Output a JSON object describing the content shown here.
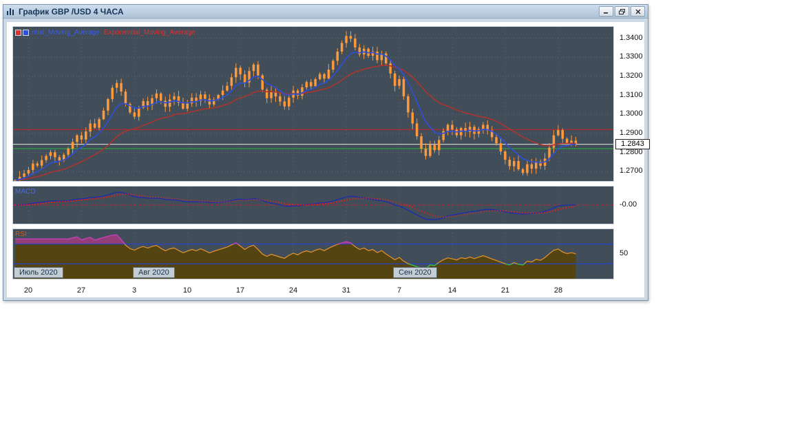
{
  "window": {
    "title": "График GBP /USD  4 ЧАСА"
  },
  "legend": {
    "ma1_label": "ntial_Moving_Average",
    "ma2_label": "Exponential_Moving_Average"
  },
  "panels": {
    "macd_label": "MACD",
    "rsi_label": "RSI"
  },
  "axis": {
    "price_ticks": [
      "1.3400",
      "1.3300",
      "1.3200",
      "1.3100",
      "1.3000",
      "1.2900",
      "1.2800",
      "1.2700"
    ],
    "current_price": "1.2843",
    "macd_zero": "-0.00",
    "rsi_mid": "50",
    "x_ticks": [
      "20",
      "27",
      "3",
      "10",
      "17",
      "24",
      "31",
      "7",
      "14",
      "21",
      "28"
    ]
  },
  "month_markers": [
    {
      "label": "Июль 2020",
      "slot": 0
    },
    {
      "label": "Авг 2020",
      "slot": 27
    },
    {
      "label": "Сен 2020",
      "slot": 86
    }
  ],
  "chart_data": {
    "type": "candlestick",
    "symbol": "GBP/USD",
    "timeframe": "4 часа",
    "title": "График GBP /USD 4 ЧАСА",
    "x_ticks": [
      "20",
      "27",
      "3",
      "10",
      "17",
      "24",
      "31",
      "7",
      "14",
      "21",
      "28"
    ],
    "x_tick_meaning": "dates Jul 20 2020 - Sep 28 2020, weekly",
    "price_panel": {
      "ylim": [
        1.265,
        1.346
      ],
      "gridline_prices": [
        1.27,
        1.28,
        1.29,
        1.3,
        1.31,
        1.32,
        1.33,
        1.34
      ],
      "closes": [
        1.2655,
        1.2672,
        1.269,
        1.2708,
        1.2742,
        1.2731,
        1.276,
        1.2782,
        1.2801,
        1.2775,
        1.2758,
        1.2788,
        1.282,
        1.2855,
        1.289,
        1.2868,
        1.291,
        1.2952,
        1.293,
        1.2975,
        1.302,
        1.308,
        1.314,
        1.3165,
        1.312,
        1.3055,
        1.301,
        1.2988,
        1.3035,
        1.307,
        1.3048,
        1.3085,
        1.311,
        1.3072,
        1.304,
        1.3078,
        1.3095,
        1.3062,
        1.303,
        1.3058,
        1.3088,
        1.307,
        1.3105,
        1.3082,
        1.3052,
        1.3078,
        1.3102,
        1.3125,
        1.315,
        1.3195,
        1.3245,
        1.321,
        1.3168,
        1.3228,
        1.3262,
        1.3205,
        1.313,
        1.3085,
        1.3122,
        1.3095,
        1.3068,
        1.3042,
        1.3088,
        1.3125,
        1.3098,
        1.3142,
        1.317,
        1.3148,
        1.3185,
        1.3212,
        1.3188,
        1.3235,
        1.3282,
        1.333,
        1.3375,
        1.3412,
        1.3398,
        1.3352,
        1.3315,
        1.3345,
        1.3308,
        1.333,
        1.3285,
        1.332,
        1.3268,
        1.3215,
        1.315,
        1.3185,
        1.3095,
        1.301,
        1.2952,
        1.2885,
        1.282,
        1.2782,
        1.284,
        1.2812,
        1.2865,
        1.2912,
        1.2945,
        1.292,
        1.289,
        1.2928,
        1.2908,
        1.2935,
        1.2898,
        1.2922,
        1.2945,
        1.2915,
        1.288,
        1.2848,
        1.2805,
        1.2762,
        1.2728,
        1.2755,
        1.2712,
        1.2692,
        1.2738,
        1.2715,
        1.2752,
        1.273,
        1.2768,
        1.2825,
        1.289,
        1.2918,
        1.2872,
        1.2845,
        1.2862,
        1.2843
      ],
      "levels": [
        {
          "price": 1.292,
          "color": "#cc2222"
        },
        {
          "price": 1.2843,
          "color": "#e8e8e8"
        },
        {
          "price": 1.282,
          "color": "#28b43c"
        }
      ],
      "ema_fast_period": 8,
      "ema_slow_period": 26,
      "candle_color": "#ff9a3c",
      "ema_fast_color": "#2e4fd6",
      "ema_slow_color": "#a83530"
    },
    "macd_panel": {
      "fast": 8,
      "slow": 22,
      "signal": 7,
      "zero_label": "-0.00",
      "macd_color": "#1b2bb0",
      "signal_color": "#e02020",
      "zero_color": "#cc2222"
    },
    "rsi_panel": {
      "period": 12,
      "levels": [
        70,
        30
      ],
      "mid_label": "50",
      "line_color": "#e8942c",
      "fill_color": "#55430e",
      "over_color": "#c03ac0",
      "under_color": "#2fc045",
      "level_color": "#2742c8"
    }
  }
}
